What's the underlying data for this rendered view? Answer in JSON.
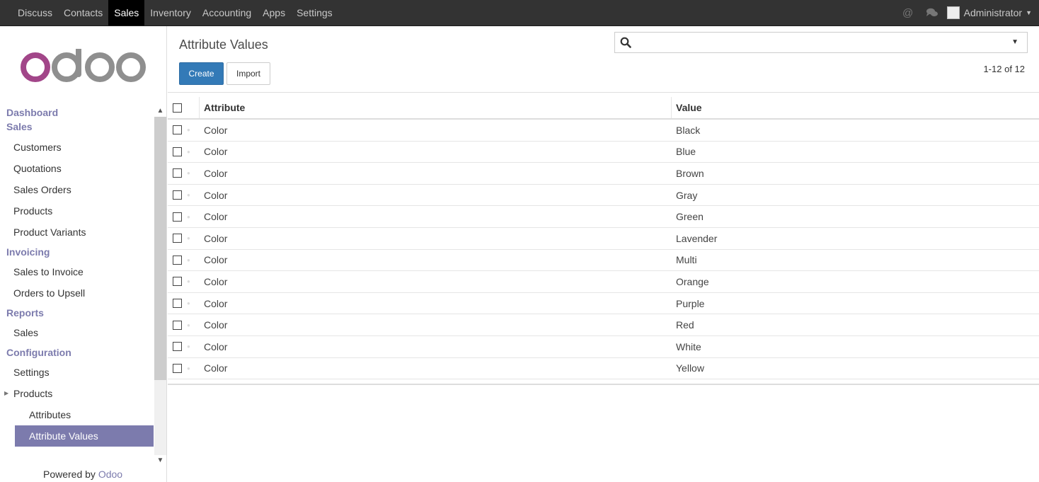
{
  "topbar": {
    "menu": [
      {
        "label": "Discuss",
        "active": false
      },
      {
        "label": "Contacts",
        "active": false
      },
      {
        "label": "Sales",
        "active": true
      },
      {
        "label": "Inventory",
        "active": false
      },
      {
        "label": "Accounting",
        "active": false
      },
      {
        "label": "Apps",
        "active": false
      },
      {
        "label": "Settings",
        "active": false
      }
    ],
    "icons": [
      "at-icon",
      "chat-icon"
    ],
    "user": "Administrator"
  },
  "sidebar": {
    "logo_text": "odoo",
    "sections": [
      {
        "header": "Dashboard",
        "items": []
      },
      {
        "header": "Sales",
        "items": [
          "Customers",
          "Quotations",
          "Sales Orders",
          "Products",
          "Product Variants"
        ]
      },
      {
        "header": "Invoicing",
        "items": [
          "Sales to Invoice",
          "Orders to Upsell"
        ]
      },
      {
        "header": "Reports",
        "items": [
          "Sales"
        ]
      },
      {
        "header": "Configuration",
        "items": [
          "Settings",
          "Products"
        ],
        "subitems": [
          "Attributes",
          "Attribute Values"
        ]
      }
    ],
    "active_item": "Attribute Values",
    "powered_by": "Powered by",
    "powered_brand": "Odoo"
  },
  "main": {
    "title": "Attribute Values",
    "create_label": "Create",
    "import_label": "Import",
    "search_placeholder": "",
    "pager": "1-12 of 12",
    "columns": [
      "Attribute",
      "Value"
    ],
    "rows": [
      {
        "attribute": "Color",
        "value": "Black"
      },
      {
        "attribute": "Color",
        "value": "Blue"
      },
      {
        "attribute": "Color",
        "value": "Brown"
      },
      {
        "attribute": "Color",
        "value": "Gray"
      },
      {
        "attribute": "Color",
        "value": "Green"
      },
      {
        "attribute": "Color",
        "value": "Lavender"
      },
      {
        "attribute": "Color",
        "value": "Multi"
      },
      {
        "attribute": "Color",
        "value": "Orange"
      },
      {
        "attribute": "Color",
        "value": "Purple"
      },
      {
        "attribute": "Color",
        "value": "Red"
      },
      {
        "attribute": "Color",
        "value": "White"
      },
      {
        "attribute": "Color",
        "value": "Yellow"
      }
    ]
  },
  "colors": {
    "brand": "#7c7bad",
    "primary": "#337ab7",
    "topbar": "#333333",
    "logo_o1": "#a24689",
    "logo_rest": "#8f8f8f"
  }
}
